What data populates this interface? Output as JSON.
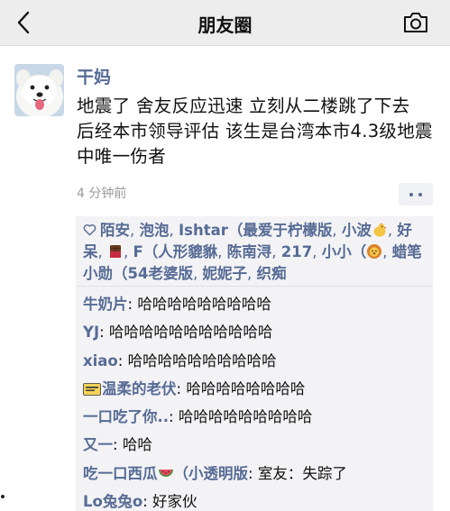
{
  "header": {
    "title": "朋友圈"
  },
  "post": {
    "author": "干妈",
    "text": "地震了 舍友反应迅速 立刻从二楼跳了下去 后经本市领导评估 该生是台湾本市4.3级地震中唯一伤者",
    "time": "4 分钟前"
  },
  "likes": {
    "names": [
      "陌安",
      "泡泡",
      "Ishtar（最爱于柠檬版",
      "小波",
      "好呆",
      "F（人形貔貅",
      "陈南浔",
      "217",
      "小小（",
      "蜡笔小勋（54老婆版",
      "妮妮子",
      "织痴"
    ]
  },
  "comments": [
    {
      "name": "牛奶片",
      "text": "哈哈哈哈哈哈哈哈哈"
    },
    {
      "name": "YJ",
      "text": "哈哈哈哈哈哈哈哈哈哈哈"
    },
    {
      "name": "xiao",
      "text": "哈哈哈哈哈哈哈哈哈哈"
    },
    {
      "name": "温柔的老伏",
      "text": "哈哈哈哈哈哈哈哈"
    },
    {
      "name": "一口吃了你..",
      "text": "哈哈哈哈哈哈哈哈哈"
    },
    {
      "name": "又一",
      "text": "哈哈"
    },
    {
      "name": "吃一口西瓜",
      "name_suffix": "（小透明版",
      "text": "室友：失踪了"
    },
    {
      "name": "Lo兔兔o",
      "text": "好家伙"
    }
  ]
}
